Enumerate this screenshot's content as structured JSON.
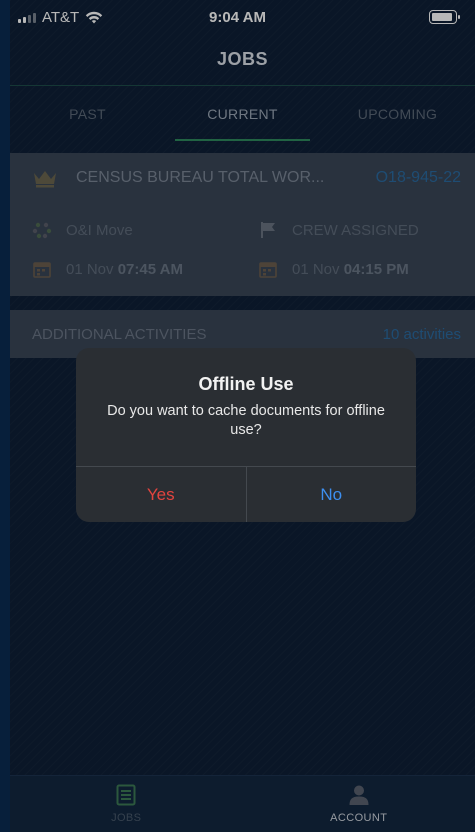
{
  "status_bar": {
    "carrier": "AT&T",
    "time": "9:04 AM"
  },
  "header": {
    "title": "JOBS"
  },
  "tabs": [
    {
      "label": "PAST",
      "active": false
    },
    {
      "label": "CURRENT",
      "active": true
    },
    {
      "label": "UPCOMING",
      "active": false
    }
  ],
  "job": {
    "title": "CENSUS BUREAU TOTAL WOR...",
    "code": "O18-945-22",
    "move_type": "O&I Move",
    "status": "CREW ASSIGNED",
    "start_date": "01 Nov",
    "start_time": "07:45 AM",
    "end_date": "01 Nov",
    "end_time": "04:15 PM"
  },
  "activities": {
    "label": "ADDITIONAL ACTIVITIES",
    "count": "10 activities"
  },
  "dialog": {
    "title": "Offline Use",
    "message": "Do you want to cache documents for offline use?",
    "yes_label": "Yes",
    "no_label": "No"
  },
  "bottom_nav": {
    "jobs_label": "JOBS",
    "account_label": "ACCOUNT"
  },
  "colors": {
    "accent_green": "#2f8a5e",
    "link_blue": "#3d8ff0",
    "destructive_red": "#e2443f"
  },
  "icons": [
    "wifi-icon",
    "battery-icon",
    "crown-icon",
    "move-icon",
    "flag-icon",
    "calendar-icon",
    "jobs-list-icon",
    "account-icon"
  ]
}
